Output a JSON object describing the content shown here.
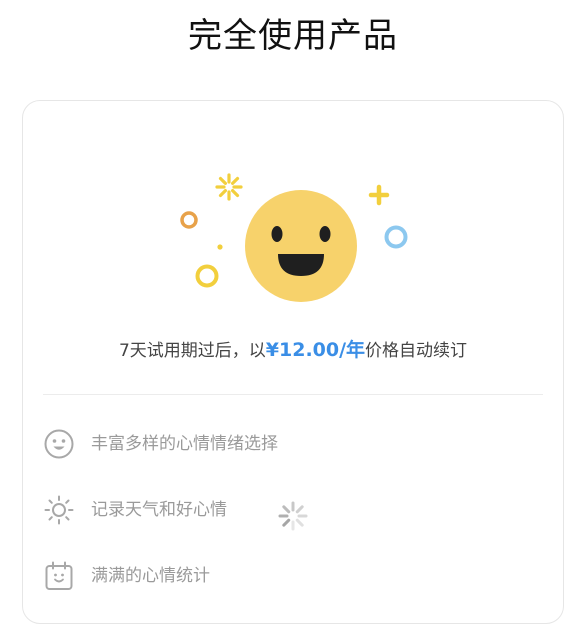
{
  "page": {
    "title": "完全使用产品"
  },
  "renewal": {
    "prefix": "7天试用期过后，以",
    "price": "¥12.00/年",
    "suffix": "价格自动续订"
  },
  "features": [
    {
      "icon": "smiley-face-icon",
      "label": "丰富多样的心情情绪选择"
    },
    {
      "icon": "sun-icon",
      "label": "记录天气和好心情"
    },
    {
      "icon": "calendar-icon",
      "label": "满满的心情统计"
    }
  ],
  "loading": {
    "icon": "loading-spinner-icon"
  },
  "colors": {
    "accent": "#3a8ee6",
    "smiley": "#f7d26b",
    "muted_text": "#9a9a9a",
    "border": "#e6e6e6"
  }
}
